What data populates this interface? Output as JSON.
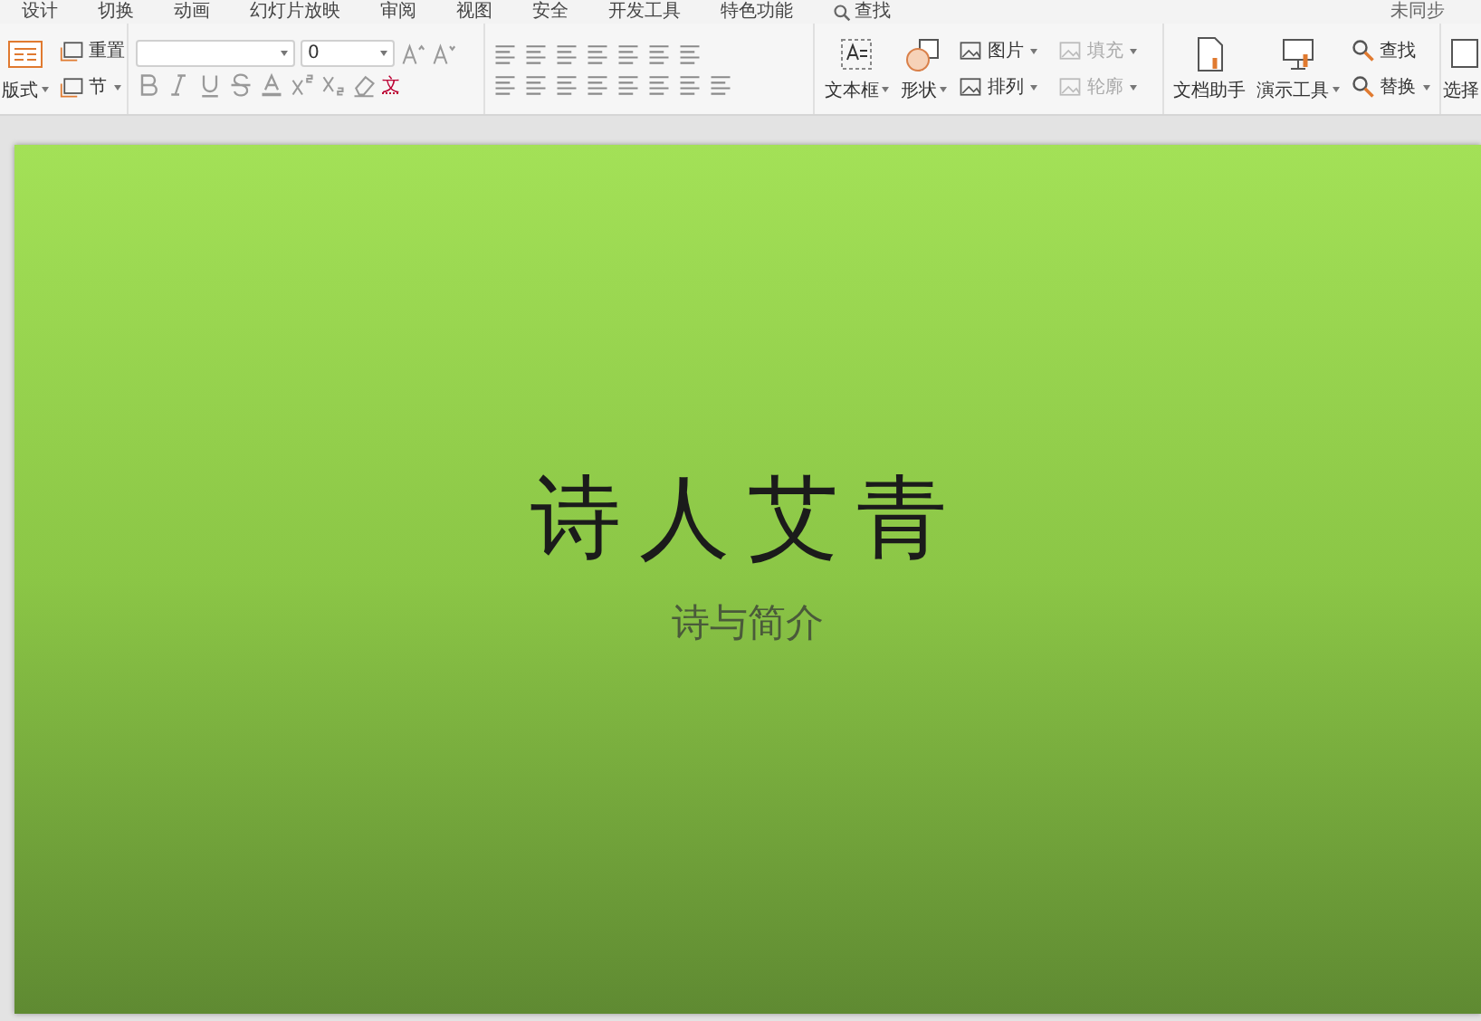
{
  "menu_tabs": [
    "设计",
    "切换",
    "动画",
    "幻灯片放映",
    "审阅",
    "视图",
    "安全",
    "开发工具",
    "特色功能"
  ],
  "search_tab": "查找",
  "sync_status": "未同步",
  "slide_group": {
    "large": {
      "label": "版式",
      "dropdown": true
    },
    "small": [
      {
        "label": "重置",
        "dropdown": false
      },
      {
        "label": "节",
        "dropdown": true
      }
    ]
  },
  "font_size": "0",
  "phonetic_label": "文",
  "insert_large": [
    {
      "label": "文本框",
      "dropdown": true
    },
    {
      "label": "形状",
      "dropdown": true
    }
  ],
  "insert_small": [
    {
      "label": "图片",
      "dropdown": true,
      "disabled": false
    },
    {
      "label": "填充",
      "dropdown": true,
      "disabled": true
    },
    {
      "label": "排列",
      "dropdown": true,
      "disabled": false
    },
    {
      "label": "轮廓",
      "dropdown": true,
      "disabled": true
    }
  ],
  "tools_large": [
    {
      "label": "文档助手",
      "dropdown": false
    },
    {
      "label": "演示工具",
      "dropdown": true
    }
  ],
  "tools_small": [
    {
      "label": "查找",
      "dropdown": false
    },
    {
      "label": "替换",
      "dropdown": true
    }
  ],
  "select_label": "选择",
  "slide": {
    "title": "诗人艾青",
    "subtitle": "诗与简介"
  }
}
